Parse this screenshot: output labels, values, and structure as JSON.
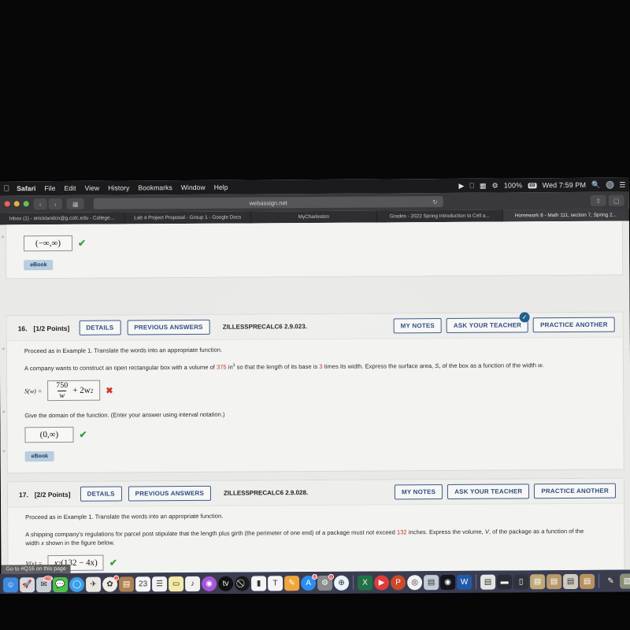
{
  "menubar": {
    "apple_icon": "apple-logo",
    "items": [
      "Safari",
      "File",
      "Edit",
      "View",
      "History",
      "Bookmarks",
      "Window",
      "Help"
    ],
    "battery_percent": "100%",
    "battery_badge": "69",
    "clock": "Wed 7:59 PM",
    "icons": [
      "play-icon",
      "airplay-icon",
      "keyboard-flag-icon",
      "control-center-icon",
      "search-icon",
      "account-avatar-icon",
      "list-icon"
    ]
  },
  "browser": {
    "url": "webassign.net",
    "reload_icon": "reload-icon",
    "back_icon": "chevron-left-icon",
    "forward_icon": "chevron-right-icon",
    "sidebar_icon": "sidebar-icon",
    "share_icon": "share-icon",
    "tabs_icon": "tabs-icon",
    "tabs": [
      "Inbox (1) - stricklandcn@g.cofc.edu - College...",
      "Lab 4 Project Proposal - Group 1 - Google Docs",
      "MyCharleston",
      "Grades - 2022 Spring Introduction to Cell a...",
      "Homework 8 - Math 111, section 7, Spring 2..."
    ],
    "active_tab_index": 4
  },
  "partial_question": {
    "answer_value": "(−∞,∞)",
    "mark": "✔",
    "ebook_label": "eBook"
  },
  "questions": [
    {
      "number": "16.",
      "points": "[1/2 Points]",
      "details_label": "DETAILS",
      "previous_answers_label": "PREVIOUS ANSWERS",
      "code": "ZILLESSPRECALC6 2.9.023.",
      "my_notes_label": "MY NOTES",
      "ask_teacher_label": "ASK YOUR TEACHER",
      "practice_another_label": "PRACTICE ANOTHER",
      "has_check_badge": true,
      "lead": "Proceed as in Example 1. Translate the words into an appropriate function.",
      "body_part1": "A company wants to construct an open rectangular box with a volume of ",
      "body_num1": "375",
      "body_part2": " in",
      "body_exp": "3",
      "body_part3": " so that the length of its base is ",
      "body_num2": "3",
      "body_part4": " times its width. Express the surface area, ",
      "body_var1": "S",
      "body_part5": ", of the box as a function of the width ",
      "body_var2": "w",
      "body_part6": ".",
      "fn_label": "S(w) =",
      "answer_numerator": "750",
      "answer_denominator": "w",
      "answer_tail": "+ 2w",
      "answer_tail_exp": "2",
      "answer_mark": "✖",
      "domain_prompt": "Give the domain of the function. (Enter your answer using interval notation.)",
      "domain_value": "(0,∞)",
      "domain_mark": "✔",
      "ebook_label": "eBook"
    },
    {
      "number": "17.",
      "points": "[2/2 Points]",
      "details_label": "DETAILS",
      "previous_answers_label": "PREVIOUS ANSWERS",
      "code": "ZILLESSPRECALC6 2.9.028.",
      "my_notes_label": "MY NOTES",
      "ask_teacher_label": "ASK YOUR TEACHER",
      "practice_another_label": "PRACTICE ANOTHER",
      "has_check_badge": false,
      "lead": "Proceed as in Example 1. Translate the words into an appropriate function.",
      "body_part1": "A shipping company's regulations for parcel post stipulate that the length plus girth (the perimeter of one end) of a package must not exceed ",
      "body_num1": "132",
      "body_part2": " inches. Express the volume, ",
      "body_var1": "V",
      "body_part3": ", of the package as a function of the width ",
      "body_var2": "x",
      "body_part4": " shown in the figure below.",
      "fn_label": "V(x) =",
      "answer_base": "x",
      "answer_exp": "2",
      "answer_rest": "(132 − 4x)",
      "answer_mark": "✔"
    }
  ],
  "status_tooltip": "Go to #Q16 on this page",
  "dock": {
    "icons": [
      {
        "name": "finder-icon",
        "glyph": "☺",
        "color": "#3c8be0",
        "badge": ""
      },
      {
        "name": "launchpad-icon",
        "glyph": "🚀",
        "color": "#d8d8de",
        "badge": ""
      },
      {
        "name": "mail-icon",
        "glyph": "✉",
        "color": "#c9cdd4",
        "badge": "1299"
      },
      {
        "name": "messages-icon",
        "glyph": "💬",
        "color": "#4cc24c",
        "badge": ""
      },
      {
        "name": "facetime-icon",
        "glyph": "◯",
        "color": "#3aa0e8",
        "badge": ""
      },
      {
        "name": "maps-icon",
        "glyph": "✈",
        "color": "#e9e7df",
        "badge": ""
      },
      {
        "name": "photos-icon",
        "glyph": "✿",
        "color": "#f0ece4",
        "badge": "1"
      },
      {
        "name": "contacts-icon",
        "glyph": "▤",
        "color": "#b08050",
        "badge": ""
      },
      {
        "name": "calendar-icon",
        "glyph": "23",
        "color": "#f5f5f5",
        "badge": ""
      },
      {
        "name": "reminders-icon",
        "glyph": "☰",
        "color": "#f2f2f2",
        "badge": ""
      },
      {
        "name": "notes-icon",
        "glyph": "▭",
        "color": "#f6e9a8",
        "badge": ""
      },
      {
        "name": "music-icon",
        "glyph": "♪",
        "color": "#f0f0f0",
        "badge": ""
      },
      {
        "name": "podcasts-icon",
        "glyph": "◉",
        "color": "#a855d8",
        "badge": ""
      },
      {
        "name": "appletv-icon",
        "glyph": "tv",
        "color": "#111111",
        "badge": ""
      },
      {
        "name": "block-icon",
        "glyph": "⃠",
        "color": "#1a1a1a",
        "badge": ""
      },
      {
        "name": "numbers-icon",
        "glyph": "▮",
        "color": "#f4f4f4",
        "badge": ""
      },
      {
        "name": "keynote-icon",
        "glyph": "T",
        "color": "#f4f4f4",
        "badge": ""
      },
      {
        "name": "pages-icon",
        "glyph": "✎",
        "color": "#f0a63c",
        "badge": ""
      },
      {
        "name": "appstore-icon",
        "glyph": "A",
        "color": "#2b8ef0",
        "badge": "12"
      },
      {
        "name": "settings-icon",
        "glyph": "⚙",
        "color": "#8a8a8e",
        "badge": "1"
      },
      {
        "name": "safari-icon",
        "glyph": "⊕",
        "color": "#e9f3fb",
        "badge": ""
      },
      {
        "name": "excel-icon",
        "glyph": "X",
        "color": "#1f7246",
        "badge": ""
      },
      {
        "name": "videoplayer-icon",
        "glyph": "▶",
        "color": "#e23b3b",
        "badge": ""
      },
      {
        "name": "powerpoint-icon",
        "glyph": "P",
        "color": "#cc4a28",
        "badge": ""
      },
      {
        "name": "chrome-icon",
        "glyph": "◎",
        "color": "#f2f2f2",
        "badge": ""
      },
      {
        "name": "preview-icon",
        "glyph": "▤",
        "color": "#c3cdd8",
        "badge": ""
      },
      {
        "name": "cofc-icon",
        "glyph": "◉",
        "color": "#14151c",
        "badge": ""
      },
      {
        "name": "word-icon",
        "glyph": "W",
        "color": "#2159a8",
        "badge": ""
      },
      {
        "name": "document-icon",
        "glyph": "▤",
        "color": "#e4e4e2",
        "badge": ""
      },
      {
        "name": "folder-window-icon",
        "glyph": "▬",
        "color": "#2b2d36",
        "badge": ""
      },
      {
        "name": "file-icon",
        "glyph": "▯",
        "color": "#30323c",
        "badge": ""
      },
      {
        "name": "downloads-icon",
        "glyph": "▤",
        "color": "#c1a878",
        "badge": ""
      },
      {
        "name": "document2-icon",
        "glyph": "▤",
        "color": "#b89a6a",
        "badge": ""
      },
      {
        "name": "document3-icon",
        "glyph": "▤",
        "color": "#cfcac0",
        "badge": ""
      },
      {
        "name": "folder-icon",
        "glyph": "▤",
        "color": "#b8925c",
        "badge": ""
      },
      {
        "name": "pencil-icon",
        "glyph": "✎",
        "color": "#3a3c48",
        "badge": ""
      },
      {
        "name": "stack-icon",
        "glyph": "▧",
        "color": "#8b8f78",
        "badge": ""
      },
      {
        "name": "screen-icon",
        "glyph": "▭",
        "color": "#c5c8cc",
        "badge": ""
      },
      {
        "name": "window-icon",
        "glyph": "▭",
        "color": "#b9bcc2",
        "badge": ""
      },
      {
        "name": "trash-icon",
        "glyph": "🗑",
        "color": "#c6c8cb",
        "badge": ""
      }
    ]
  }
}
